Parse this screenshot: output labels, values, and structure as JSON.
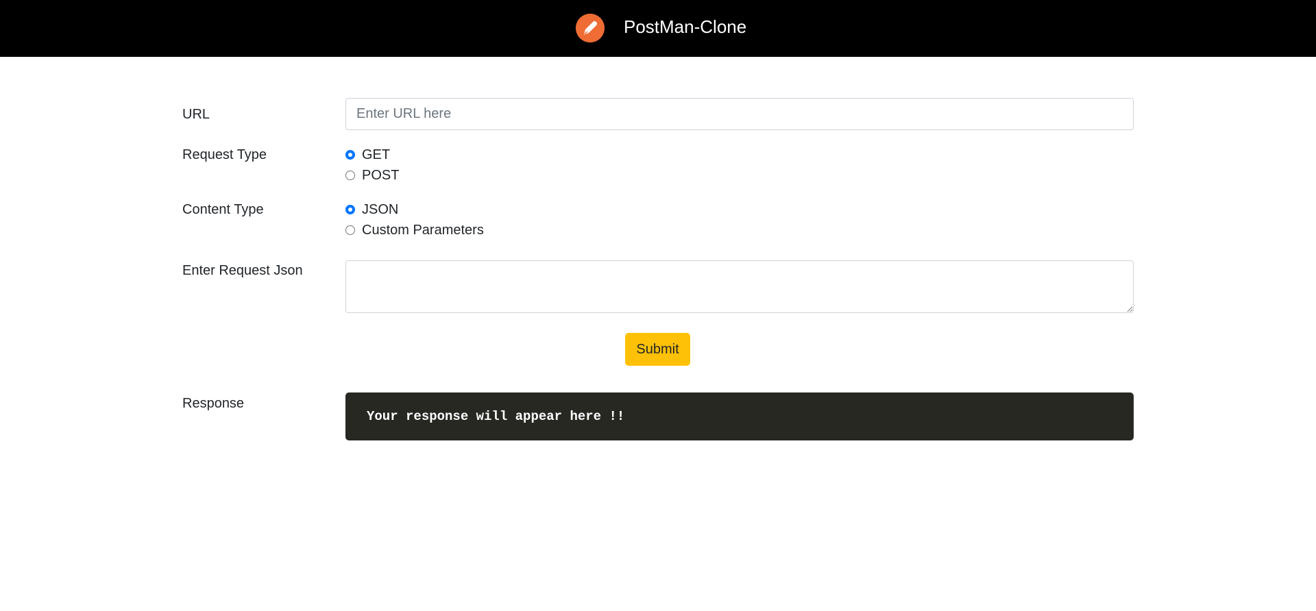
{
  "header": {
    "logo_icon": "postman-logo-icon",
    "title": "PostMan-Clone",
    "background": "#000000",
    "logo_color": "#ef6c35"
  },
  "form": {
    "url": {
      "label": "URL",
      "value": "",
      "placeholder": "Enter URL here"
    },
    "request_type": {
      "label": "Request Type",
      "options": [
        {
          "label": "GET",
          "checked": true
        },
        {
          "label": "POST",
          "checked": false
        }
      ]
    },
    "content_type": {
      "label": "Content Type",
      "options": [
        {
          "label": "JSON",
          "checked": true
        },
        {
          "label": "Custom Parameters",
          "checked": false
        }
      ]
    },
    "request_json": {
      "label": "Enter Request Json",
      "value": ""
    },
    "submit_label": "Submit",
    "submit_color": "#ffc107"
  },
  "response": {
    "label": "Response",
    "text": "Your response will appear here !!",
    "background": "#272822"
  }
}
